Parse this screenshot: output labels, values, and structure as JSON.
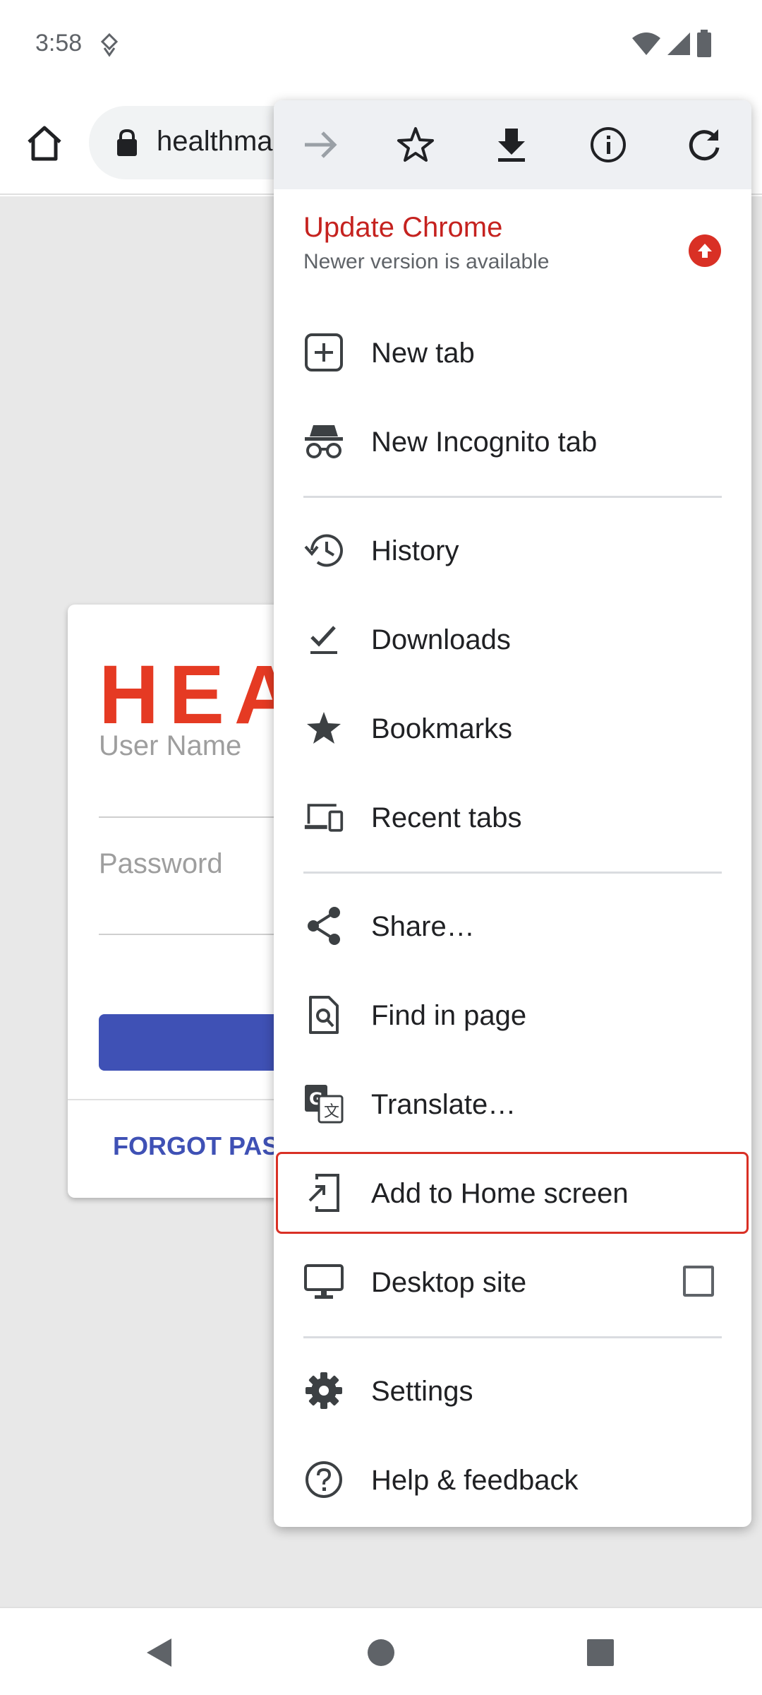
{
  "status_bar": {
    "time": "3:58"
  },
  "toolbar": {
    "url": "healthma"
  },
  "page": {
    "brand": "HEA",
    "username_label": "User Name",
    "password_label": "Password",
    "forgot_link": "FORGOT PASS"
  },
  "menu": {
    "update": {
      "title": "Update Chrome",
      "subtitle": "Newer version is available"
    },
    "items": [
      {
        "label": "New tab",
        "icon": "new-tab-icon"
      },
      {
        "label": "New Incognito tab",
        "icon": "incognito-icon"
      },
      {
        "label": "History",
        "icon": "history-icon"
      },
      {
        "label": "Downloads",
        "icon": "downloads-icon"
      },
      {
        "label": "Bookmarks",
        "icon": "bookmarks-icon"
      },
      {
        "label": "Recent tabs",
        "icon": "recent-tabs-icon"
      },
      {
        "label": "Share…",
        "icon": "share-icon"
      },
      {
        "label": "Find in page",
        "icon": "find-in-page-icon"
      },
      {
        "label": "Translate…",
        "icon": "translate-icon"
      },
      {
        "label": "Add to Home screen",
        "icon": "add-to-home-icon",
        "highlighted": true
      },
      {
        "label": "Desktop site",
        "icon": "desktop-icon",
        "checked": false
      },
      {
        "label": "Settings",
        "icon": "settings-icon"
      },
      {
        "label": "Help & feedback",
        "icon": "help-icon"
      }
    ]
  },
  "colors": {
    "accent": "#3f51b5",
    "brand": "#e53a23",
    "update": "#c5221f",
    "highlight": "#d93025"
  }
}
